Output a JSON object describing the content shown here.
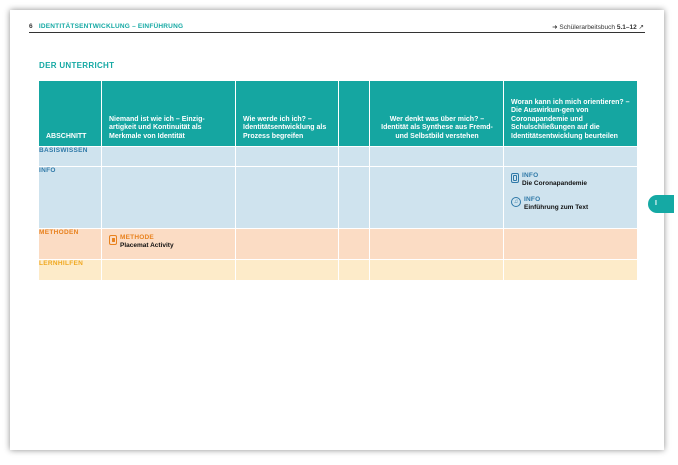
{
  "header": {
    "page_number": "6",
    "chapter": "IDENTITÄTSENTWICKLUNG – EINFÜHRUNG",
    "arrow": "➜",
    "workbook_label": "Schülerarbeitsbuch",
    "workbook_pages": "5.1–12",
    "next_arrow": "↗"
  },
  "section_title": "DER UNTERRICHT",
  "side_tab": "I",
  "table": {
    "columns": [
      "ABSCHNITT",
      "Niemand ist wie ich – Einzig-artigkeit und Kontinuität als Merkmale von Identität",
      "Wie werde ich ich? – Identitätsentwicklung als Prozess begreifen",
      "",
      "Wer denkt was über mich? – Identität als Synthese aus Fremd- und Selbstbild verstehen",
      "Woran kann ich mich orientieren? – Die Auswirkun-gen von Coronapandemie und Schulschließungen auf die Identitätsentwicklung beurteilen"
    ],
    "rows": {
      "basiswissen": "BASISWISSEN",
      "info": "INFO",
      "methoden": "METHODEN",
      "lernhilfen": "LERNHILFEN"
    },
    "info_entries": [
      {
        "type": "INFO",
        "title": "Die Coronapandemie",
        "icon": "phone-icon"
      },
      {
        "type": "INFO",
        "title": "Einführung zum Text",
        "icon": "audio-icon"
      }
    ],
    "method_entry": {
      "type": "METHODE",
      "title": "Placemat Activity",
      "icon": "method-card-icon"
    }
  },
  "colors": {
    "teal": "#15a6a1",
    "light_blue": "#cfe3ee",
    "peach": "#fbdcc4",
    "light_yellow": "#fdebc9",
    "blue_label": "#2f79a8",
    "orange_label": "#e8821e"
  }
}
